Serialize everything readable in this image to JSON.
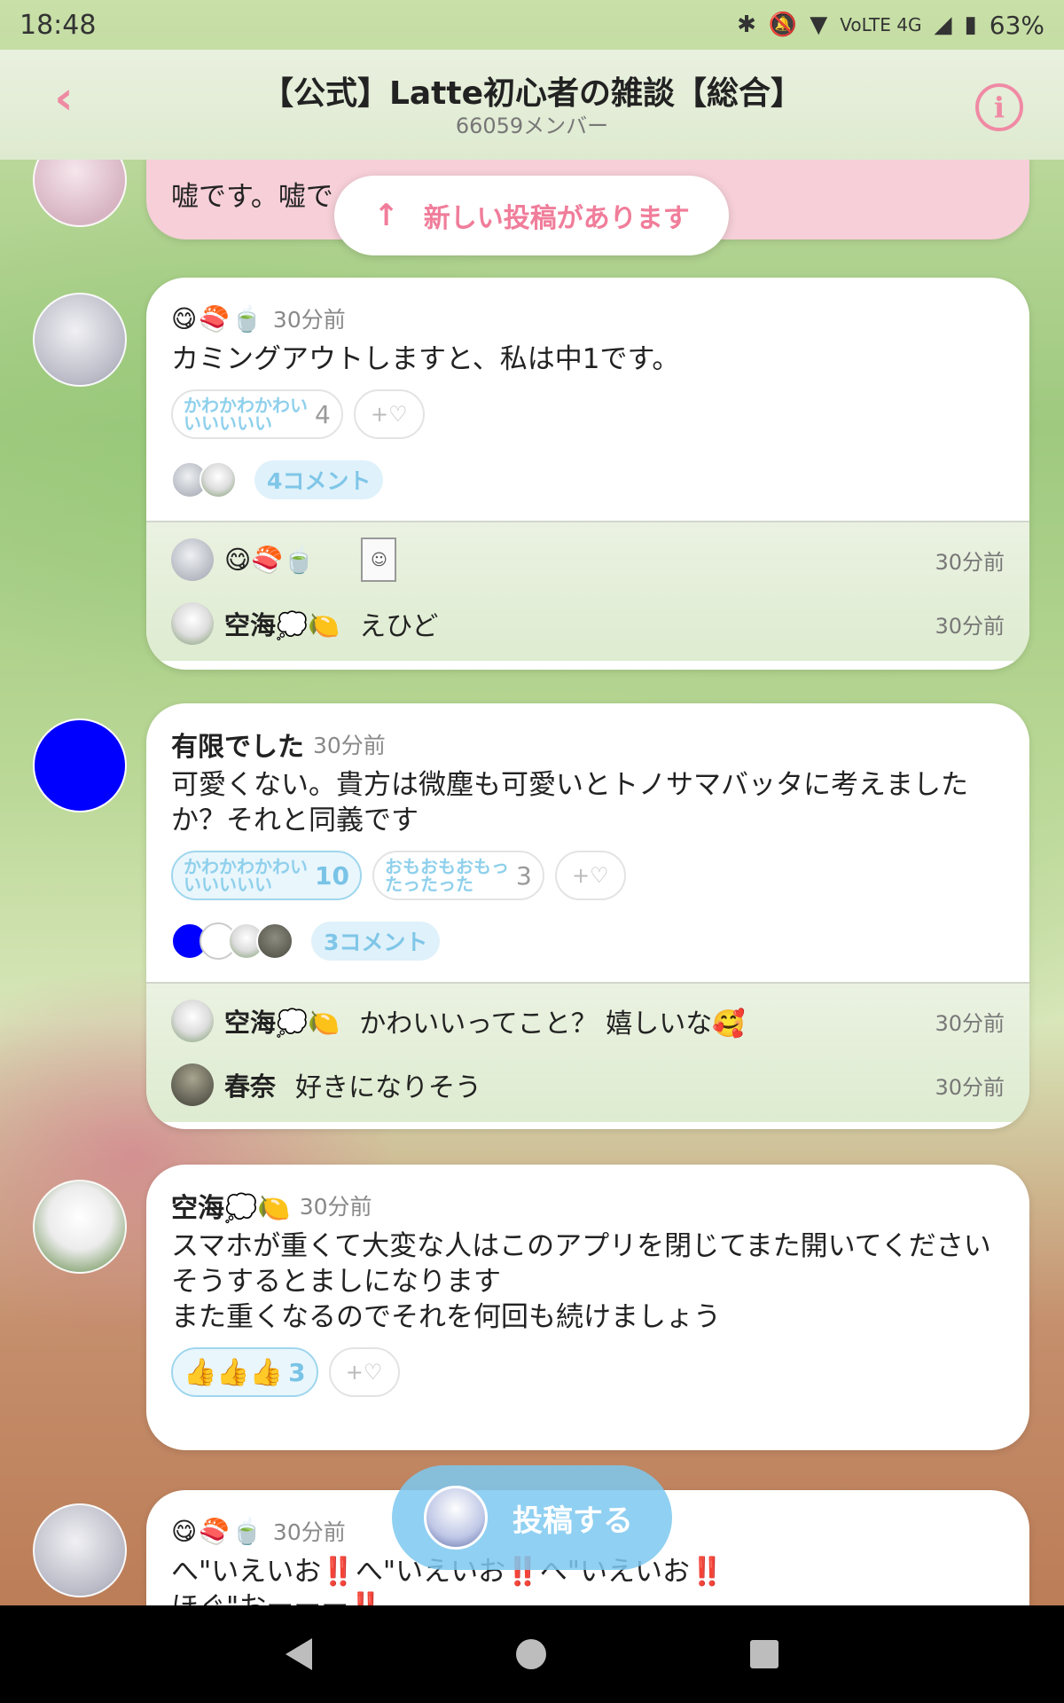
{
  "status": {
    "time": "18:48",
    "network": "VoLTE 4G",
    "battery": "63%"
  },
  "header": {
    "title": "【公式】Latte初心者の雑談【総合】",
    "members": "66059メンバー"
  },
  "banner": {
    "new_posts": "新しい投稿があります"
  },
  "post0": {
    "text": "嘘です。嘘で",
    "time": "30分前"
  },
  "post1": {
    "name": "😋🍣🍵",
    "time": "30分前",
    "text": "カミングアウトしますと、私は中1です。",
    "reaction1_label": "かわかわかわいいいいいい",
    "reaction1_count": "4",
    "add_reaction": "+♡",
    "comments": "4コメント",
    "replies": [
      {
        "name": "😋🍣🍵",
        "text": "",
        "time": "30分前"
      },
      {
        "name": "空海💭🍋",
        "text": "えひど",
        "time": "30分前"
      }
    ]
  },
  "post2": {
    "name": "有限でした",
    "time": "30分前",
    "text": "可愛くない。貴方は微塵も可愛いとトノサマバッタに考えましたか？それと同義です",
    "reaction1_label": "かわかわかわいいいいいい",
    "reaction1_count": "10",
    "reaction2_label": "おもおもおもったったった",
    "reaction2_count": "3",
    "add_reaction": "+♡",
    "comments": "3コメント",
    "replies": [
      {
        "name": "空海💭🍋",
        "text": "かわいいってこと？ 嬉しいな🥰",
        "time": "30分前"
      },
      {
        "name": "春奈",
        "text": "好きになりそう",
        "time": "30分前"
      }
    ]
  },
  "post3": {
    "name": "空海💭🍋",
    "time": "30分前",
    "text": "スマホが重くて大変な人はこのアプリを閉じてまた開いてください\nそうするとましになります\nまた重くなるのでそれを何回も続けましょう",
    "reaction1_label": "👍👍👍",
    "reaction1_count": "3",
    "add_reaction": "+♡"
  },
  "post4": {
    "name": "😋🍣🍵",
    "time": "30分前",
    "text": "へ\"いえいお‼️へ\"いえいお‼️へ\"いえいお‼️\nほぐ\"おーーー‼️"
  },
  "fab": {
    "label": "投稿する"
  }
}
